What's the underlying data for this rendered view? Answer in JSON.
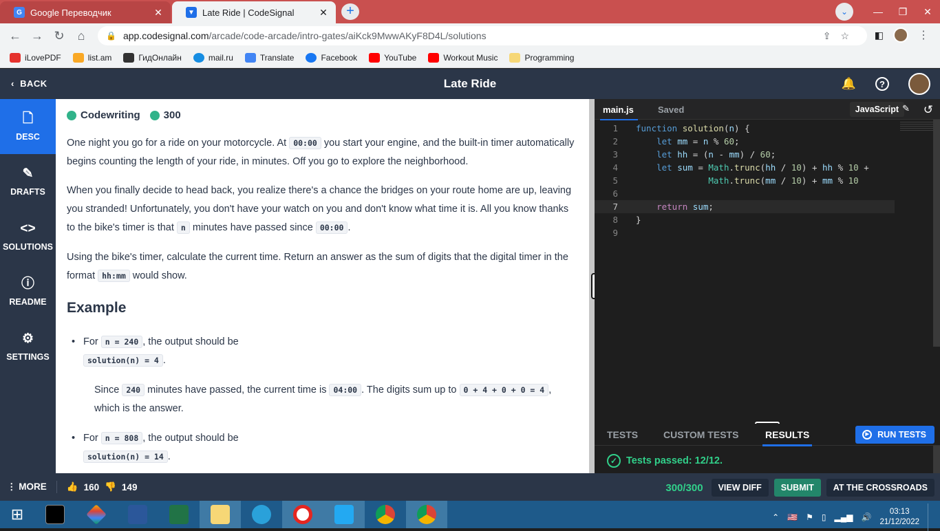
{
  "browser": {
    "tabs": [
      {
        "title": "Google Переводчик",
        "active": false
      },
      {
        "title": "Late Ride | CodeSignal",
        "active": true
      }
    ],
    "url_host": "app.codesignal.com",
    "url_path": "/arcade/code-arcade/intro-gates/aiKck9MwwAKyF8D4L/solutions",
    "bookmarks": [
      "iLovePDF",
      "list.am",
      "ГидОнлайн",
      "mail.ru",
      "Translate",
      "Facebook",
      "YouTube",
      "Workout Music",
      "Programming"
    ]
  },
  "header": {
    "back_label": "BACK",
    "title": "Late Ride"
  },
  "sidebar": {
    "items": [
      {
        "label": "DESC",
        "icon": "document-icon",
        "glyph": "🗋"
      },
      {
        "label": "DRAFTS",
        "icon": "drafts-icon",
        "glyph": "✎"
      },
      {
        "label": "SOLUTIONS",
        "icon": "code-brackets-icon",
        "glyph": "<>"
      },
      {
        "label": "README",
        "icon": "info-icon",
        "glyph": "ⓘ"
      },
      {
        "label": "SETTINGS",
        "icon": "gear-icon",
        "glyph": "⚙"
      }
    ]
  },
  "task": {
    "type_label": "Codewriting",
    "points": "300",
    "p1_a": "One night you go for a ride on your motorcycle. At ",
    "p1_code": "00:00",
    "p1_b": " you start your engine, and the built-in timer automatically begins counting the length of your ride, in minutes. Off you go to explore the neighborhood.",
    "p2_a": "When you finally decide to head back, you realize there's a chance the bridges on your route home are up, leaving you stranded! Unfortunately, you don't have your watch on you and don't know what time it is. All you know thanks to the bike's timer is that ",
    "p2_code1": "n",
    "p2_b": " minutes have passed since ",
    "p2_code2": "00:00",
    "p2_c": ".",
    "p3_a": "Using the bike's timer, calculate the current time. Return an answer as the sum of digits that the digital timer in the format ",
    "p3_code": "hh:mm",
    "p3_b": " would show.",
    "example_heading": "Example",
    "ex1_for": "For ",
    "ex1_code": "n = 240",
    "ex1_mid": ", the output should be",
    "ex1_sol": "solution(n) = 4",
    "ex1_dot": ".",
    "ex1_since_a": "Since ",
    "ex1_since_code1": "240",
    "ex1_since_b": " minutes have passed, the current time is ",
    "ex1_since_code2": "04:00",
    "ex1_since_c": ". The digits sum up to ",
    "ex1_since_code3": "0 + 4 + 0 + 0 = 4",
    "ex1_since_d": ", which is the answer.",
    "ex2_for": "For ",
    "ex2_code": "n = 808",
    "ex2_mid": ", the output should be",
    "ex2_sol": "solution(n) = 14",
    "ex2_dot": "."
  },
  "editor": {
    "file_tab": "main.js",
    "saved_label": "Saved",
    "language": "JavaScript",
    "line_numbers": [
      "1",
      "2",
      "3",
      "4",
      "5",
      "6",
      "7",
      "8",
      "9"
    ]
  },
  "results": {
    "tabs": [
      "TESTS",
      "CUSTOM TESTS",
      "RESULTS"
    ],
    "run_label": "RUN TESTS",
    "passed_text": "Tests passed: 12/12."
  },
  "footer": {
    "more_label": "MORE",
    "likes": "160",
    "dislikes": "149",
    "score": "300/300",
    "view_diff": "VIEW DIFF",
    "submit": "SUBMIT",
    "next": "AT THE CROSSROADS"
  },
  "taskbar": {
    "time": "03:13",
    "date": "21/12/2022"
  }
}
